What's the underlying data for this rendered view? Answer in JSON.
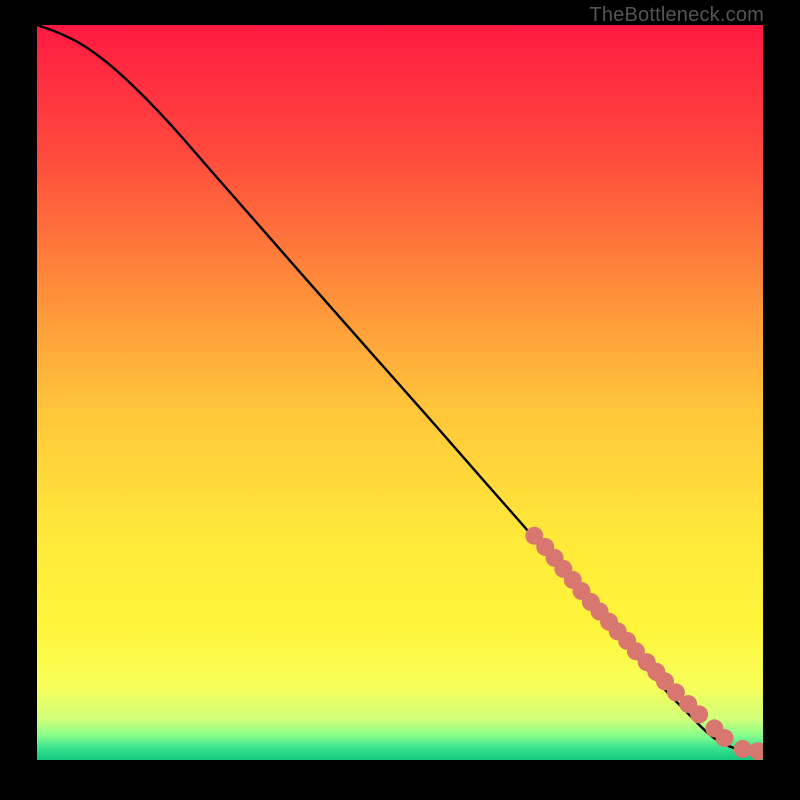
{
  "watermark": "TheBottleneck.com",
  "chart_data": {
    "type": "line",
    "title": "",
    "xlabel": "",
    "ylabel": "",
    "xlim": [
      0,
      100
    ],
    "ylim": [
      0,
      100
    ],
    "grid": false,
    "axes_visible": false,
    "background_gradient": {
      "stops": [
        {
          "pos": 0.0,
          "color": "#ff1a41"
        },
        {
          "pos": 0.18,
          "color": "#ff4b3d"
        },
        {
          "pos": 0.35,
          "color": "#ff8a3a"
        },
        {
          "pos": 0.52,
          "color": "#ffc53a"
        },
        {
          "pos": 0.7,
          "color": "#ffe93a"
        },
        {
          "pos": 0.82,
          "color": "#fff53a"
        },
        {
          "pos": 0.9,
          "color": "#f8ff5a"
        },
        {
          "pos": 0.945,
          "color": "#d0ff7a"
        },
        {
          "pos": 0.965,
          "color": "#8eff8a"
        },
        {
          "pos": 0.985,
          "color": "#35e08d"
        },
        {
          "pos": 1.0,
          "color": "#12c97e"
        }
      ]
    },
    "series": [
      {
        "name": "bottleneck-curve",
        "x": [
          0,
          3,
          7,
          12,
          18,
          25,
          33,
          41,
          50,
          58,
          66,
          74,
          80,
          86,
          90,
          93,
          96,
          99,
          100
        ],
        "y": [
          100,
          99,
          97,
          93,
          87,
          79,
          70,
          61,
          51,
          42,
          33,
          24,
          17,
          10,
          6,
          3,
          1.5,
          1,
          1
        ]
      }
    ],
    "scatter_points": {
      "name": "marked-devices",
      "color": "#d7776f",
      "x": [
        68.5,
        70,
        71.3,
        72.5,
        73.8,
        75,
        76.3,
        77.5,
        78.8,
        80,
        81.3,
        82.5,
        84,
        85.3,
        86.5,
        88,
        89.7,
        91.2,
        93.3,
        94.7,
        97.2,
        99.3
      ],
      "y": [
        30.5,
        29,
        27.5,
        26,
        24.5,
        23,
        21.5,
        20.2,
        18.8,
        17.5,
        16.2,
        14.8,
        13.3,
        12,
        10.7,
        9.2,
        7.6,
        6.2,
        4.3,
        3.0,
        1.5,
        1.2
      ]
    }
  }
}
